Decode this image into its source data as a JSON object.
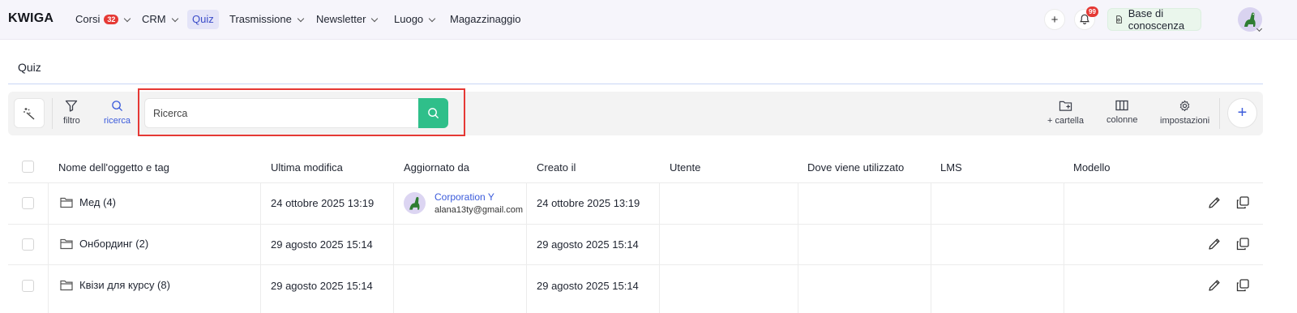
{
  "logo": "KWIGA",
  "nav": [
    {
      "label": "Corsi",
      "badge": "32",
      "has_dropdown": true
    },
    {
      "label": "CRM",
      "has_dropdown": true
    },
    {
      "label": "Quiz",
      "active": true
    },
    {
      "label": "Trasmissione",
      "has_dropdown": true
    },
    {
      "label": "Newsletter",
      "has_dropdown": true
    },
    {
      "label": "Luogo",
      "has_dropdown": true
    },
    {
      "label": "Magazzinaggio"
    }
  ],
  "header_right": {
    "add_icon": "plus-icon",
    "notifications_badge": "99",
    "knowledge_base_label": "Base di conoscenza"
  },
  "page": {
    "title": "Quiz"
  },
  "toolbar": {
    "filter_label": "filtro",
    "search_label": "ricerca",
    "search_placeholder": "Ricerca",
    "add_folder_label": "+ cartella",
    "columns_label": "colonne",
    "settings_label": "impostazioni"
  },
  "table": {
    "columns": [
      "Nome dell'oggetto e tag",
      "Ultima modifica",
      "Aggiornato da",
      "Creato il",
      "Utente",
      "Dove viene utilizzato",
      "LMS",
      "Modello"
    ],
    "rows": [
      {
        "name": "Мед (4)",
        "modified": "24 ottobre 2025 13:19",
        "updated_by_name": "Corporation Y",
        "updated_by_email": "alana13ty@gmail.com",
        "created": "24 ottobre 2025 13:19"
      },
      {
        "name": "Онбординг (2)",
        "modified": "29 agosto 2025 15:14",
        "updated_by_name": "",
        "updated_by_email": "",
        "created": "29 agosto 2025 15:14"
      },
      {
        "name": "Квізи для курсу (8)",
        "modified": "29 agosto 2025 15:14",
        "updated_by_name": "",
        "updated_by_email": "",
        "created": "29 agosto 2025 15:14"
      }
    ]
  },
  "colors": {
    "accent": "#3b5bdb",
    "search_button": "#2fbf8a",
    "badge": "#e53935",
    "highlight": "#e53935"
  }
}
